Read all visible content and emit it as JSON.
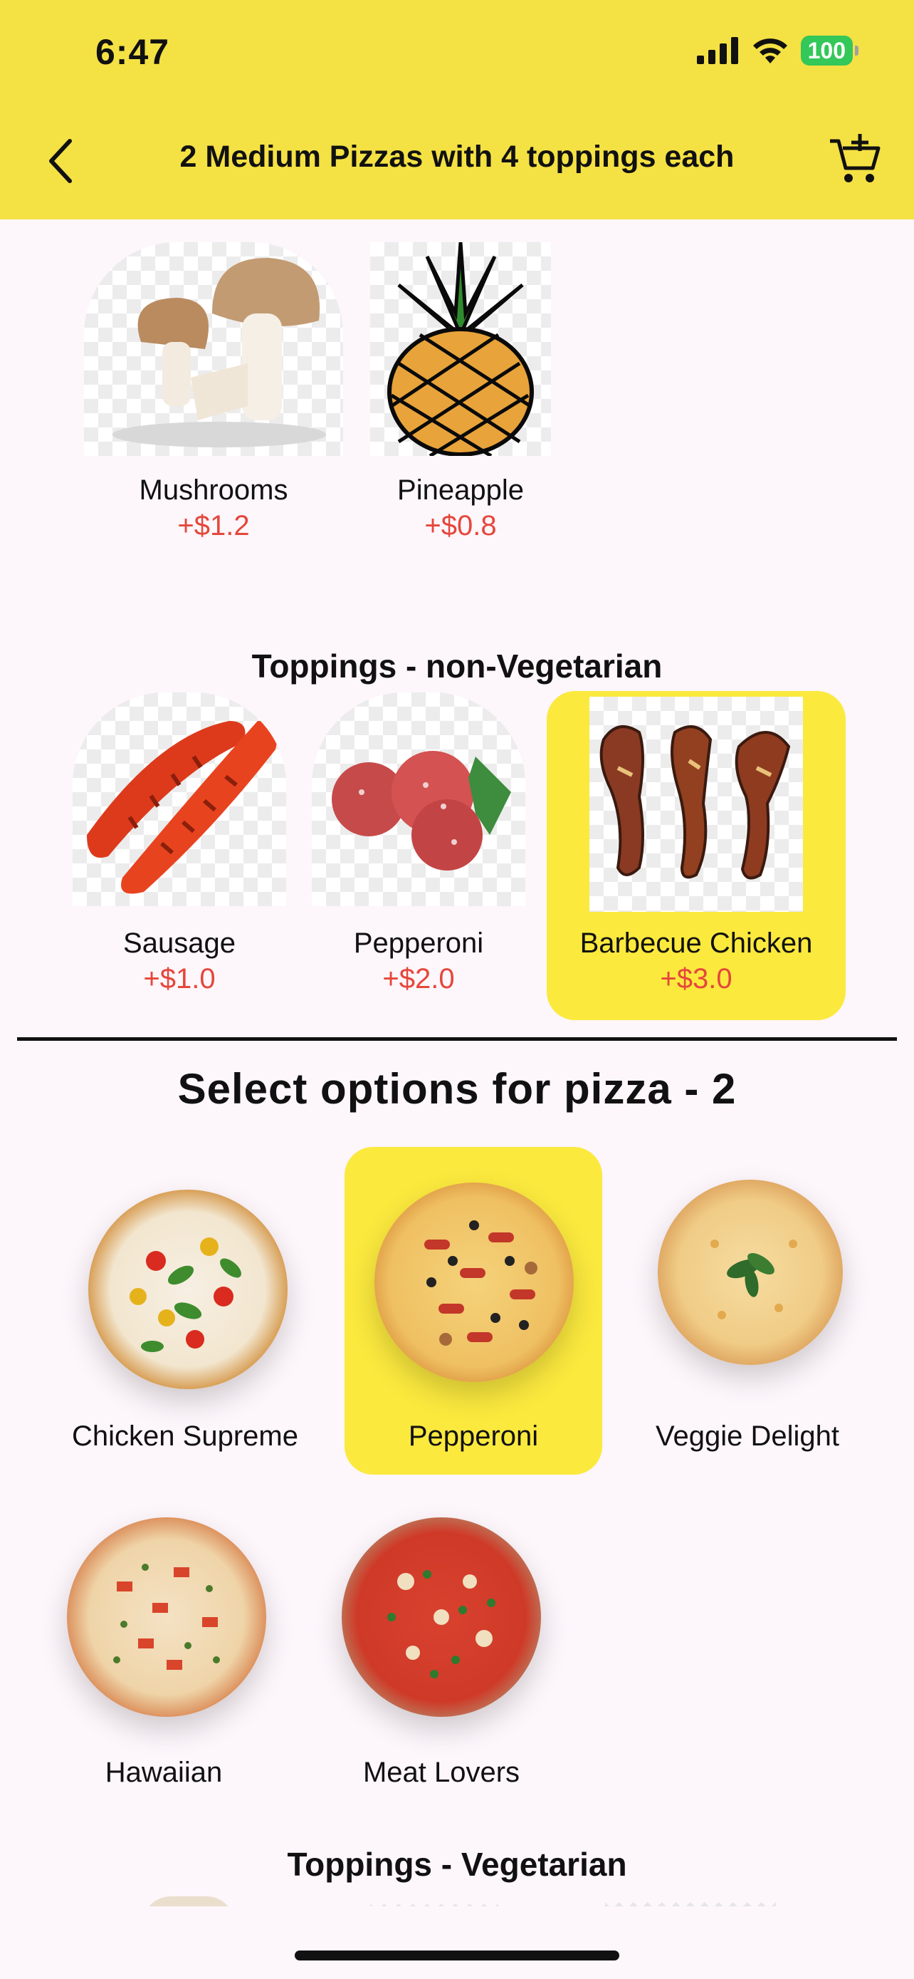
{
  "status": {
    "time": "6:47",
    "battery": "100"
  },
  "header": {
    "title": "2 Medium Pizzas with 4 toppings each"
  },
  "veg_top": [
    {
      "name": "Mushrooms",
      "price": "+$1.2"
    },
    {
      "name": "Pineapple",
      "price": "+$0.8"
    }
  ],
  "nonveg": {
    "title": "Toppings - non-Vegetarian",
    "items": [
      {
        "name": "Sausage",
        "price": "+$1.0"
      },
      {
        "name": "Pepperoni",
        "price": "+$2.0"
      },
      {
        "name": "Barbecue Chicken",
        "price": "+$3.0"
      }
    ]
  },
  "options": {
    "title": "Select options for pizza - 2",
    "pizzas": [
      {
        "name": "Chicken Supreme"
      },
      {
        "name": "Pepperoni"
      },
      {
        "name": "Veggie Delight"
      },
      {
        "name": "Hawaiian"
      },
      {
        "name": "Meat Lovers"
      }
    ]
  },
  "veg_section_title": "Toppings - Vegetarian",
  "colors": {
    "accent": "#f4e144",
    "selected": "#fbe93e",
    "price": "#e5473b"
  }
}
